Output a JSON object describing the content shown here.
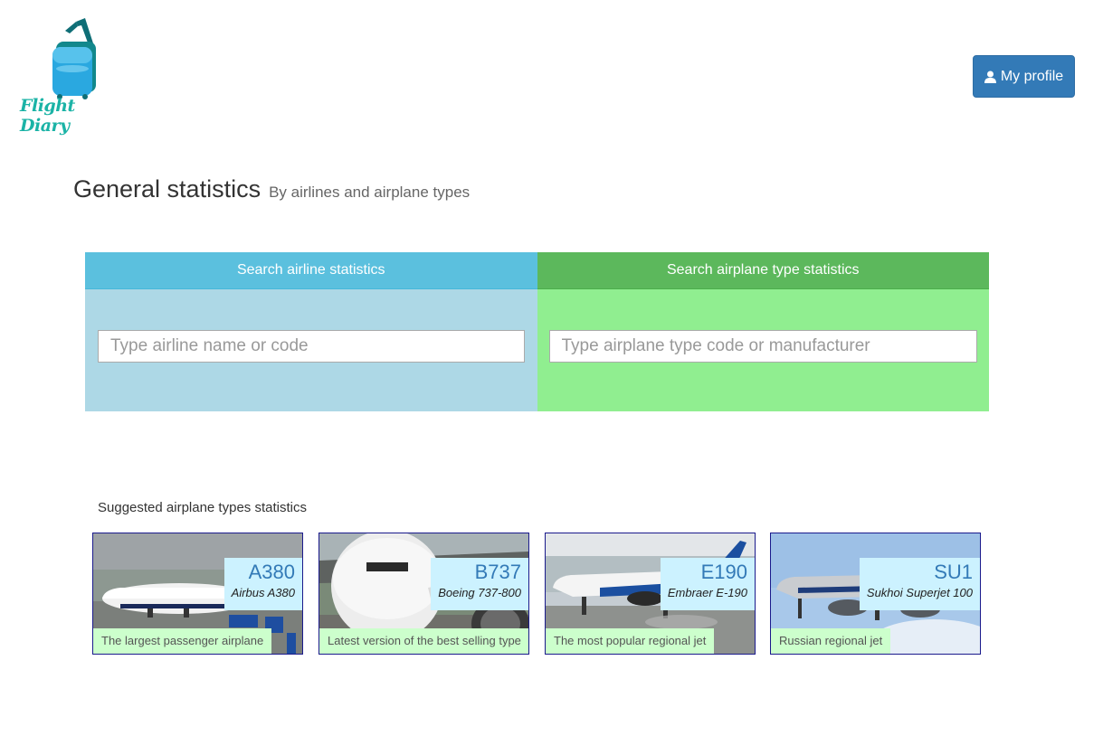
{
  "app": {
    "logo_text": "Flight Diary",
    "profile_button": "My profile"
  },
  "header": {
    "title": "General statistics",
    "subtitle": "By airlines and airplane types"
  },
  "search": {
    "airline": {
      "heading": "Search airline statistics",
      "placeholder": "Type airline name or code",
      "value": ""
    },
    "airplane_type": {
      "heading": "Search airplane type statistics",
      "placeholder": "Type airplane type code or manufacturer",
      "value": ""
    }
  },
  "suggested": {
    "label": "Suggested airplane types statistics",
    "cards": [
      {
        "code": "A380",
        "name": "Airbus A380",
        "description": "The largest passenger airplane"
      },
      {
        "code": "B737",
        "name": "Boeing 737-800",
        "description": "Latest version of the best selling type"
      },
      {
        "code": "E190",
        "name": "Embraer E-190",
        "description": "The most popular regional jet"
      },
      {
        "code": "SU1",
        "name": "Sukhoi Superjet 100",
        "description": "Russian regional jet"
      }
    ]
  },
  "colors": {
    "primary": "#337ab7",
    "airline_panel": "#add8e6",
    "airline_header": "#5bc0de",
    "type_panel": "#90ee90",
    "type_header": "#5cb85c",
    "code_box": "#ccf2ff",
    "desc_box": "#ccffcc",
    "logo": "#1bb3a6"
  },
  "icons": {
    "profile": "user-icon",
    "logo": "suitcase-icon"
  }
}
